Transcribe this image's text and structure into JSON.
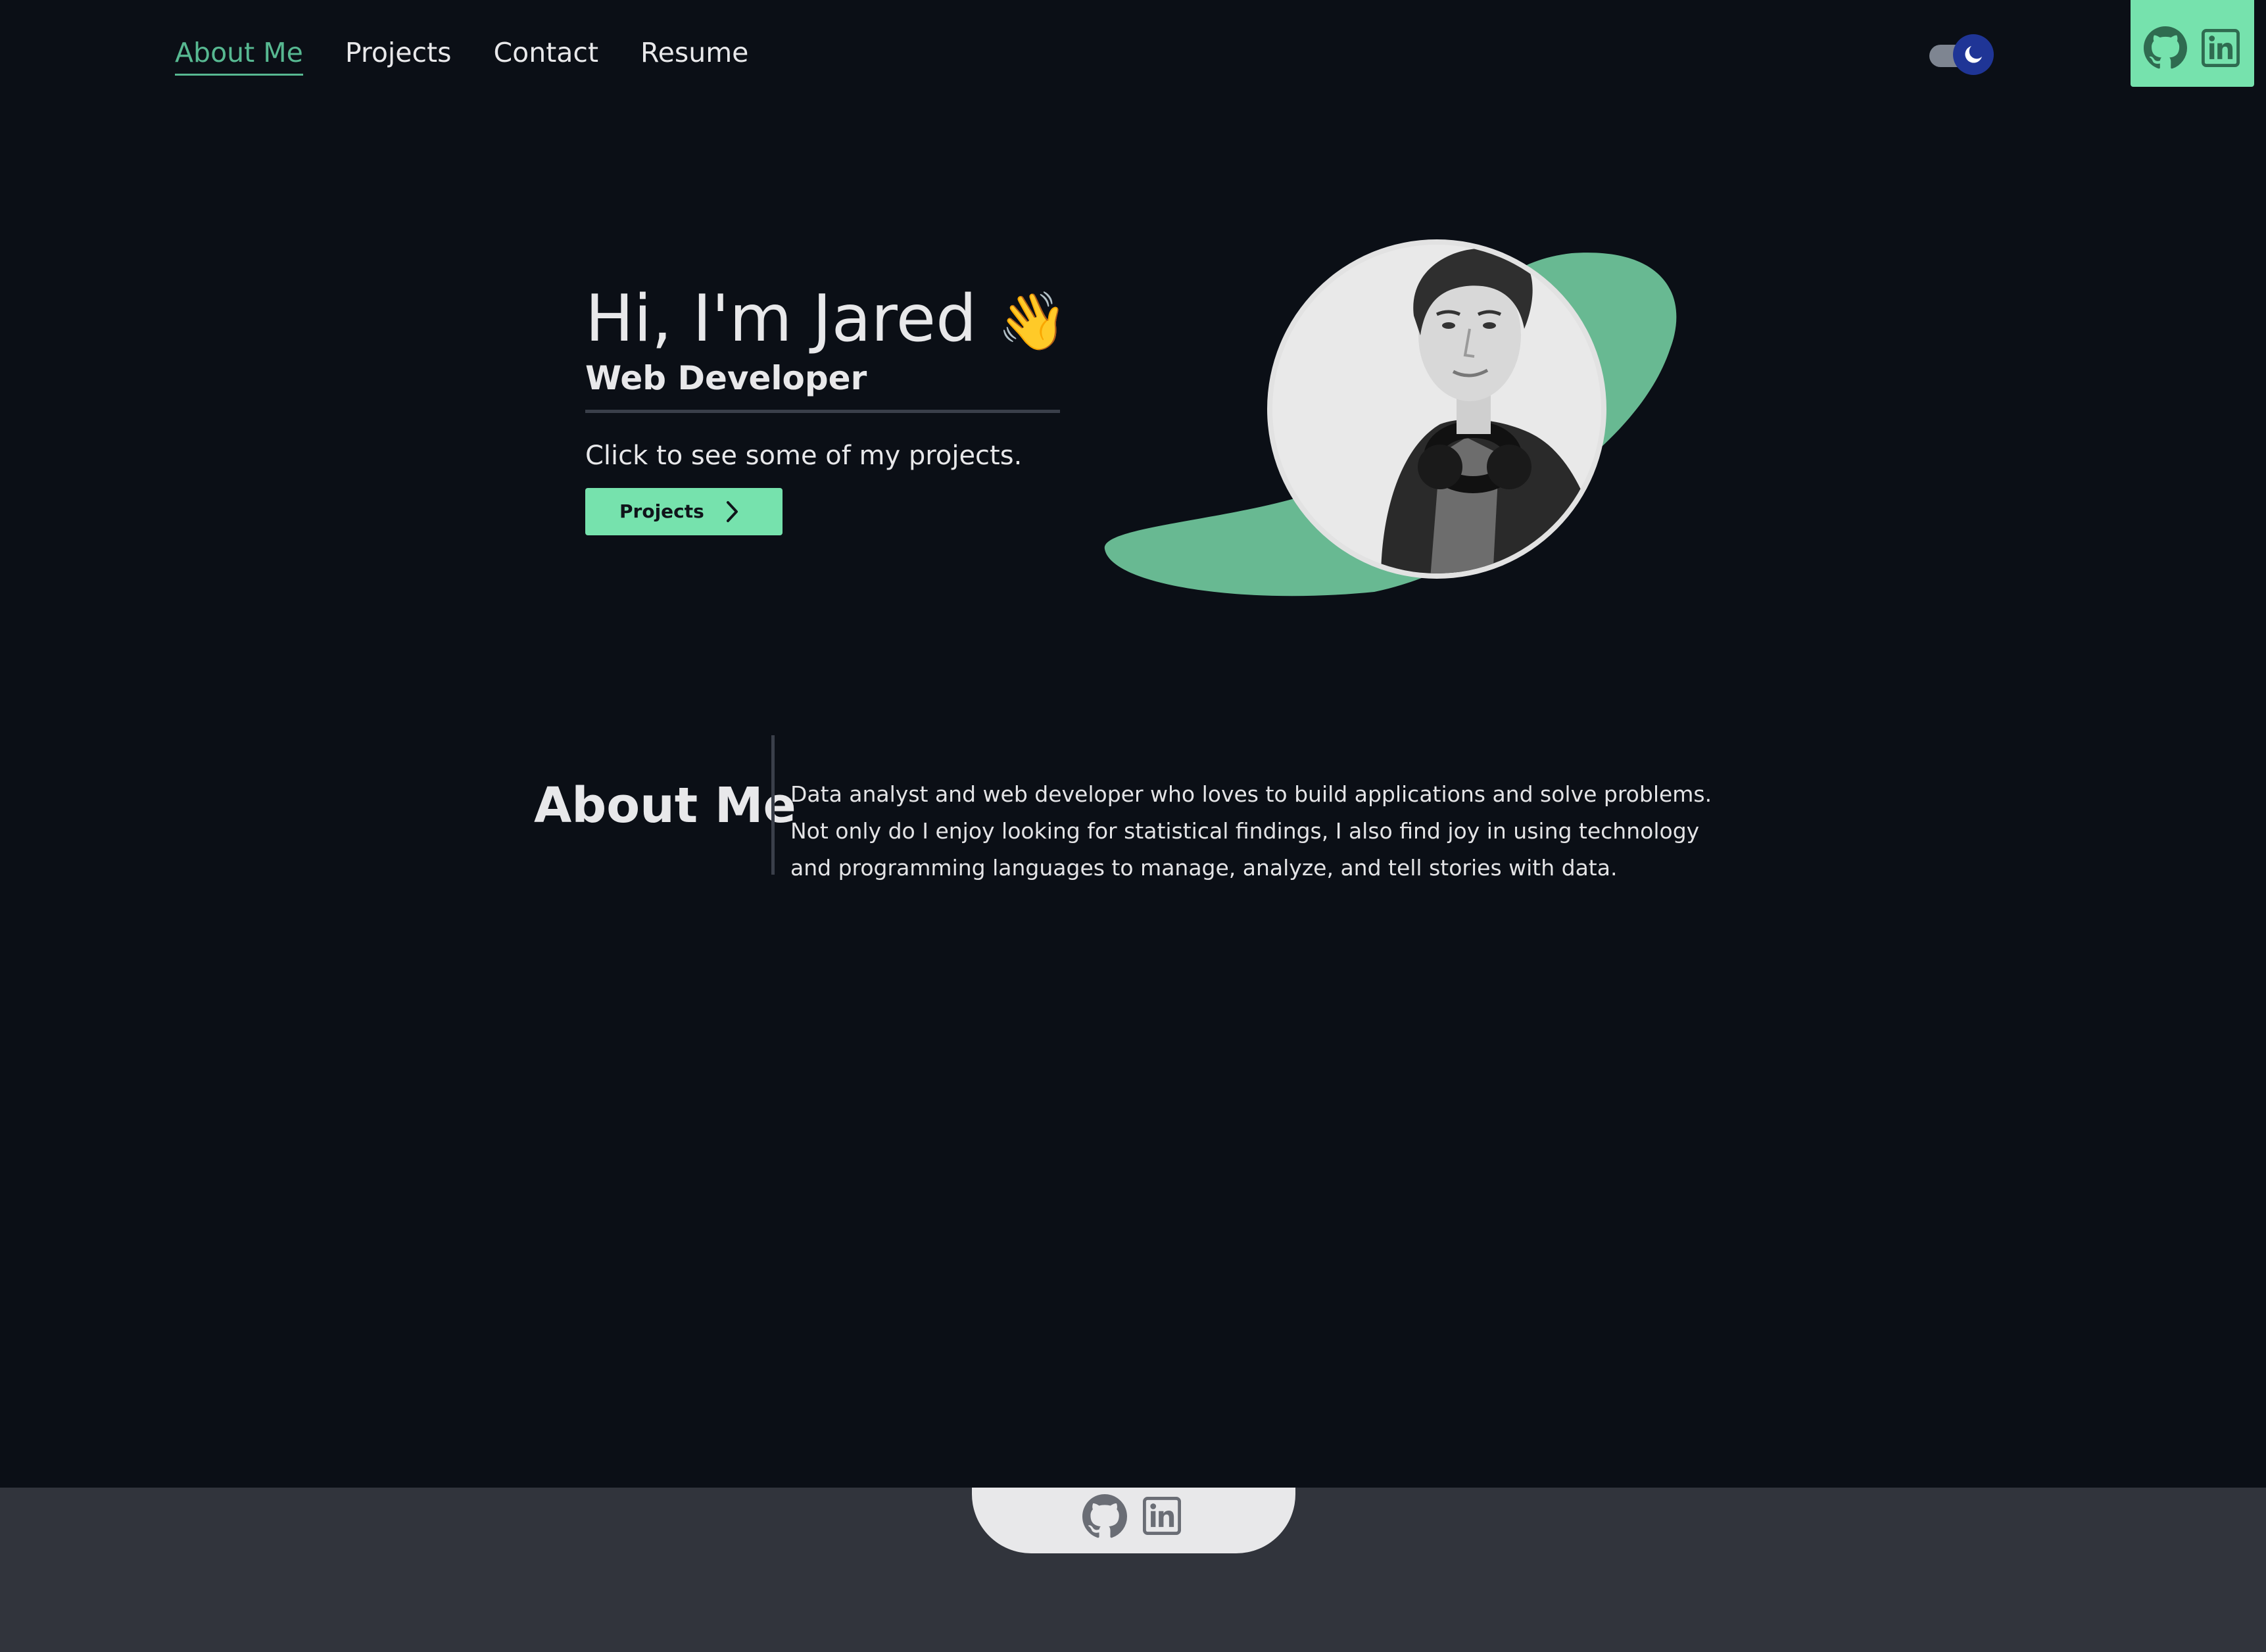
{
  "nav": {
    "links": [
      {
        "label": "About Me",
        "active": true
      },
      {
        "label": "Projects",
        "active": false
      },
      {
        "label": "Contact",
        "active": false
      },
      {
        "label": "Resume",
        "active": false
      }
    ],
    "theme_toggle": {
      "mode": "dark",
      "icon": "moon-icon"
    },
    "social_icons": [
      "github-icon",
      "linkedin-icon"
    ]
  },
  "hero": {
    "greeting": "Hi, I'm Jared",
    "wave_emoji": "👋",
    "subtitle": "Web Developer",
    "cta_text": "Click to see some of my projects.",
    "button_label": "Projects"
  },
  "about": {
    "heading": "About Me",
    "text": "Data analyst and web developer who loves to build applications and solve problems. Not only do I enjoy looking for statistical findings, I also find joy in using technology and programming languages to manage, analyze, and tell stories with data."
  },
  "footer": {
    "social_icons": [
      "github-icon",
      "linkedin-icon"
    ]
  },
  "colors": {
    "background": "#0b0f16",
    "accent": "#76e2ad",
    "accent_dark": "#5fb890",
    "footer_bg": "#31343c",
    "toggle_knob": "#1f3596"
  }
}
